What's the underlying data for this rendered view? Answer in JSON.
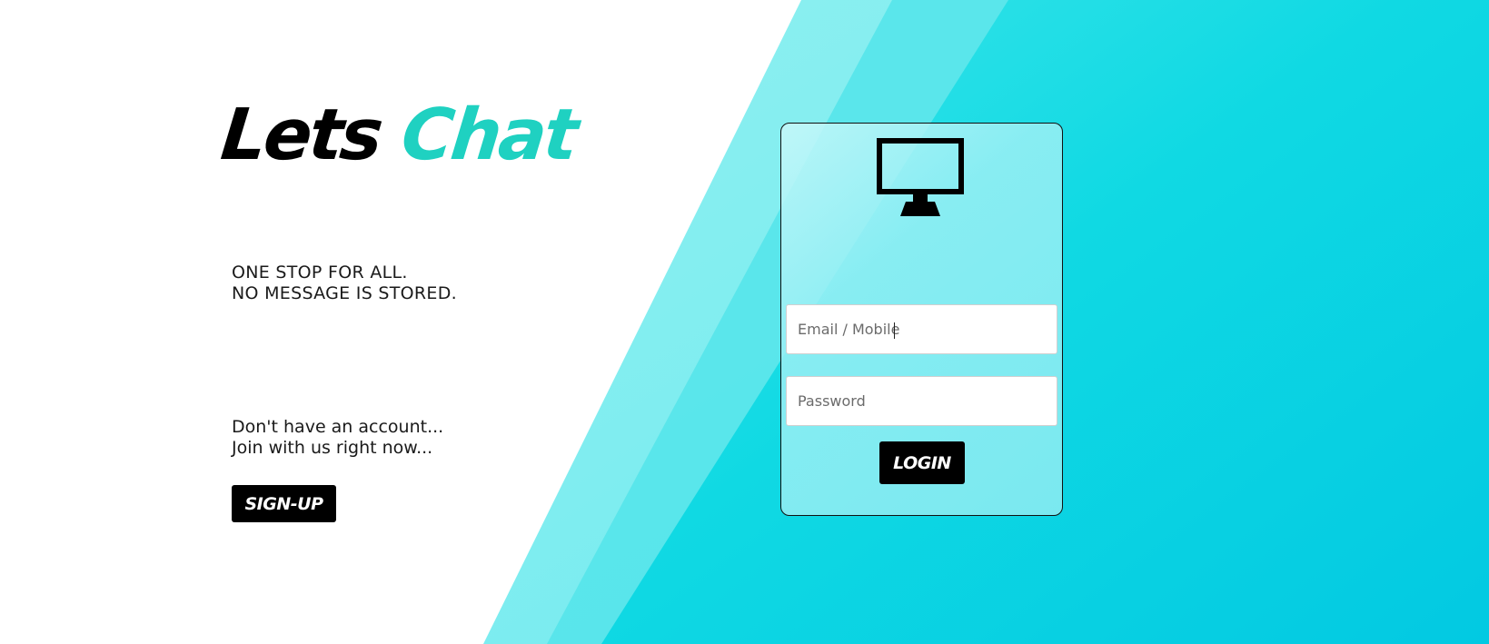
{
  "brand": {
    "word1": "Lets",
    "word2": "Chat"
  },
  "tagline": {
    "line1": "ONE STOP FOR ALL.",
    "line2": "NO MESSAGE IS STORED."
  },
  "signup": {
    "line1": "Don't have an account...",
    "line2": "Join with us right now...",
    "button_label": "SIGN-UP"
  },
  "login_form": {
    "icon": "monitor-icon",
    "email_placeholder": "Email / Mobile",
    "password_placeholder": "Password",
    "button_label": "LOGIN"
  },
  "colors": {
    "accent": "#1fd1c1",
    "background_cyan": "#0dd5e2",
    "button": "#000000"
  }
}
